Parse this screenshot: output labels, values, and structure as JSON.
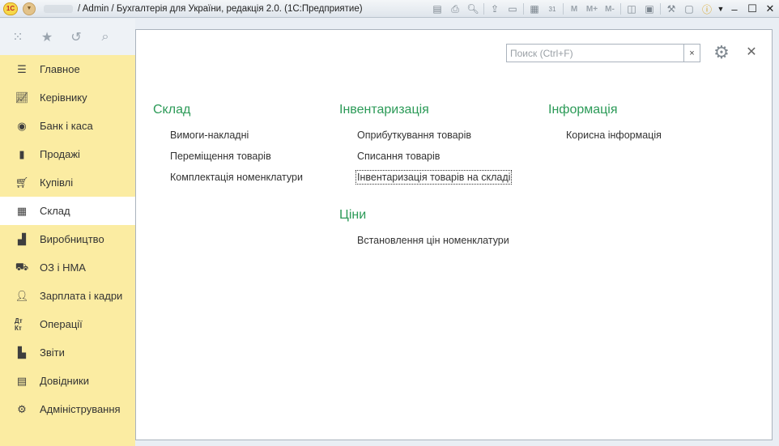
{
  "titlebar": {
    "title": "/ Admin / Бухгалтерія для України, редакція 2.0.  (1С:Предприятие)",
    "logo_text": "1С",
    "tools": [
      "save-icon",
      "print-icon",
      "preview-icon",
      "send-icon",
      "print2-icon",
      "table-icon",
      "calendar-icon"
    ],
    "mem_labels": [
      "M",
      "M+",
      "M-"
    ],
    "calendar_day": "31"
  },
  "search": {
    "placeholder": "Поиск (Ctrl+F)",
    "value": "",
    "clear": "×"
  },
  "sidebar": {
    "items": [
      {
        "label": "Главное",
        "icon": "menu-icon"
      },
      {
        "label": "Керівнику",
        "icon": "trend-icon"
      },
      {
        "label": "Банк і каса",
        "icon": "coin-icon"
      },
      {
        "label": "Продажі",
        "icon": "bag-icon"
      },
      {
        "label": "Купівлі",
        "icon": "cart-icon"
      },
      {
        "label": "Склад",
        "icon": "grid-icon",
        "active": true
      },
      {
        "label": "Виробництво",
        "icon": "factory-icon"
      },
      {
        "label": "ОЗ і НМА",
        "icon": "truck-icon"
      },
      {
        "label": "Зарплата і кадри",
        "icon": "person-icon"
      },
      {
        "label": "Операції",
        "icon": "dtkt-icon"
      },
      {
        "label": "Звіти",
        "icon": "bars-icon"
      },
      {
        "label": "Довідники",
        "icon": "books-icon"
      },
      {
        "label": "Адміністрування",
        "icon": "gear-icon"
      }
    ]
  },
  "groups": {
    "sklad": {
      "title": "Склад",
      "items": [
        "Вимоги-накладні",
        "Переміщення товарів",
        "Комплектація номенклатури"
      ]
    },
    "inventory": {
      "title": "Інвентаризація",
      "items": [
        "Оприбуткування товарів",
        "Списання товарів",
        "Інвентаризація товарів на складі"
      ]
    },
    "prices": {
      "title": "Ціни",
      "items": [
        "Встановлення цін номенклатури"
      ]
    },
    "info": {
      "title": "Інформація",
      "items": [
        "Корисна інформація"
      ]
    }
  },
  "colors": {
    "sidebar_bg": "#fbeca2",
    "group_title": "#2b9a57",
    "active_item_bg": "#ffffff"
  }
}
